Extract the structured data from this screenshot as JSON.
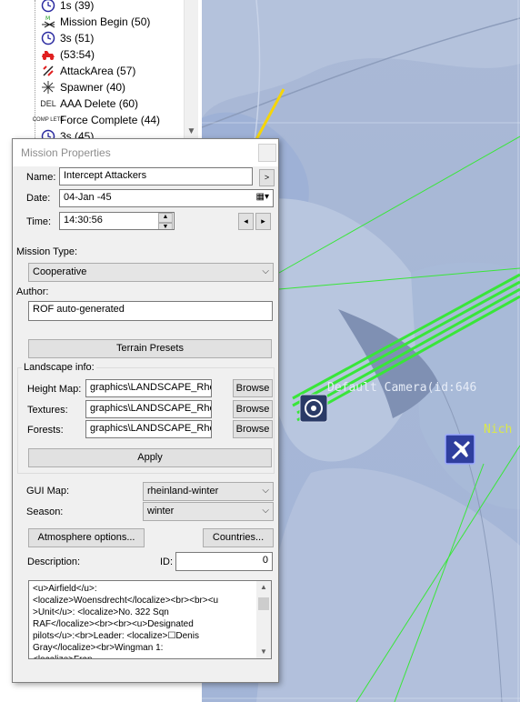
{
  "tree": {
    "items": [
      {
        "label": "1s (39)",
        "icon": "clock-icon"
      },
      {
        "label": "Mission Begin (50)",
        "icon": "mission-begin-icon"
      },
      {
        "label": "3s (51)",
        "icon": "clock-icon"
      },
      {
        "label": "(53:54)",
        "icon": "red-vehicle-icon"
      },
      {
        "label": "AttackArea (57)",
        "icon": "attack-area-icon"
      },
      {
        "label": "Spawner (40)",
        "icon": "spawner-icon"
      },
      {
        "label": "AAA Delete (60)",
        "icon": "delete-icon",
        "icon_text": "DEL"
      },
      {
        "label": "Force Complete (44)",
        "icon": "complete-icon",
        "icon_text": "COMP LETE"
      },
      {
        "label": "3s (45)",
        "icon": "clock-icon"
      }
    ],
    "mission_begin_icon_text": "M"
  },
  "dialog": {
    "title": "Mission Properties",
    "name_label": "Name:",
    "name_value": "Intercept Attackers",
    "name_btn": ">",
    "date_label": "Date:",
    "date_value": "04-Jan -45",
    "time_label": "Time:",
    "time_value": "14:30:56",
    "time_prev": "◂",
    "time_next": "▸",
    "mission_type_label": "Mission Type:",
    "mission_type_value": "Cooperative",
    "author_label": "Author:",
    "author_value": "ROF auto-generated",
    "terrain_presets_btn": "Terrain Presets",
    "landscape_group": "Landscape info:",
    "height_map_label": "Height Map:",
    "height_map_value": "graphics\\LANDSCAPE_Rheir",
    "textures_label": "Textures:",
    "textures_value": "graphics\\LANDSCAPE_Rheir",
    "forests_label": "Forests:",
    "forests_value": "graphics\\LANDSCAPE_Rheir",
    "browse_btn": "Browse",
    "apply_btn": "Apply",
    "gui_map_label": "GUI Map:",
    "gui_map_value": "rheinland-winter",
    "season_label": "Season:",
    "season_value": "winter",
    "atmosphere_btn": "Atmosphere options...",
    "countries_btn": "Countries...",
    "description_label": "Description:",
    "id_label": "ID:",
    "id_value": "0",
    "description_lines": [
      "<u>Airfield</u>:",
      "<localize>Woensdrecht</localize><br><br><u",
      ">Unit</u>: <localize>No. 322 Sqn",
      "RAF</localize><br><br><u>Designated",
      "pilots</u>:<br>Leader: <localize>☐Denis",
      "Gray</localize><br>Wingman 1:",
      "<localize>Fran"
    ]
  },
  "map": {
    "camera_label": "Default Camera(id:646",
    "object_label": "Nich",
    "colors": {
      "background": "#a9bad9",
      "flight_path": "#39e639",
      "arrow": "#f5d50a"
    }
  }
}
